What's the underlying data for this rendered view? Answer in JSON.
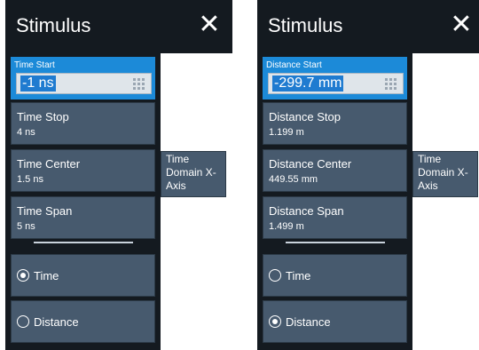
{
  "left": {
    "title": "Stimulus",
    "close_glyph": "✕",
    "active": {
      "label": "Time Start",
      "value": "-1 ns"
    },
    "buttons": [
      {
        "label": "Time Stop",
        "value": "4 ns"
      },
      {
        "label": "Time Center",
        "value": "1.5 ns"
      },
      {
        "label": "Time Span",
        "value": "5 ns"
      }
    ],
    "radios": [
      {
        "label": "Time",
        "selected": true
      },
      {
        "label": "Distance",
        "selected": false
      }
    ],
    "side_button": "Time Domain X-Axis"
  },
  "right": {
    "title": "Stimulus",
    "close_glyph": "✕",
    "active": {
      "label": "Distance Start",
      "value": "-299.7 mm"
    },
    "buttons": [
      {
        "label": "Distance Stop",
        "value": "1.199 m"
      },
      {
        "label": "Distance Center",
        "value": "449.55 mm"
      },
      {
        "label": "Distance Span",
        "value": "1.499 m"
      }
    ],
    "radios": [
      {
        "label": "Time",
        "selected": false
      },
      {
        "label": "Distance",
        "selected": true
      }
    ],
    "side_button": "Time Domain X-Axis"
  },
  "icons": {
    "close": "close-icon",
    "keypad": "keypad-icon",
    "radio": "radio-icon"
  },
  "colors": {
    "panel_bg": "#141a20",
    "button_bg": "#475a6e",
    "accent": "#1c8ad8"
  }
}
